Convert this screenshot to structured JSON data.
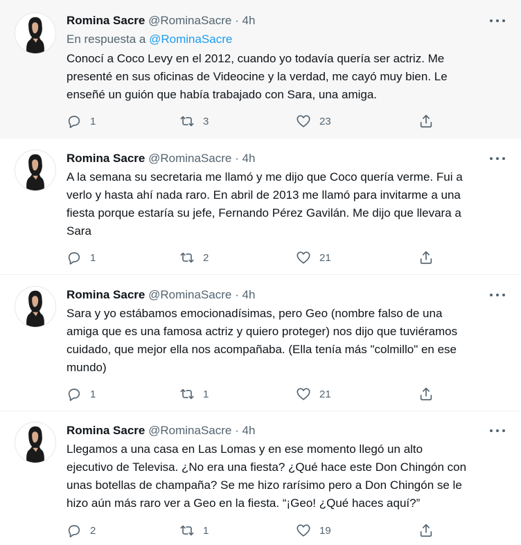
{
  "tweets": [
    {
      "name": "Romina Sacre",
      "handle": "@RominaSacre",
      "dot": "·",
      "time": "4h",
      "reply_prefix": "En respuesta a ",
      "reply_handle": "@RominaSacre",
      "text": "Conocí a Coco Levy en el 2012, cuando yo todavía quería ser actriz. Me\npresenté en sus oficinas de Videocine y la verdad, me cayó muy bien. Le\nenseñé un guión que había trabajado con Sara, una amiga.",
      "replies": "1",
      "retweets": "3",
      "likes": "23"
    },
    {
      "name": "Romina Sacre",
      "handle": "@RominaSacre",
      "dot": "·",
      "time": "4h",
      "text": "A la semana su secretaria me llamó y me dijo que Coco quería verme. Fui a\nverlo y hasta ahí nada raro. En abril de 2013 me llamó para invitarme a una\nfiesta porque estaría su jefe, Fernando Pérez Gavilán. Me dijo que llevara a\nSara",
      "replies": "1",
      "retweets": "2",
      "likes": "21"
    },
    {
      "name": "Romina Sacre",
      "handle": "@RominaSacre",
      "dot": "·",
      "time": "4h",
      "text": "Sara y yo estábamos emocionadísimas, pero Geo (nombre falso de una\namiga que es una famosa actriz y quiero proteger) nos dijo que tuviéramos\ncuidado, que mejor ella nos acompañaba. (Ella tenía más \"colmillo\" en ese\nmundo)",
      "replies": "1",
      "retweets": "1",
      "likes": "21"
    },
    {
      "name": "Romina Sacre",
      "handle": "@RominaSacre",
      "dot": "·",
      "time": "4h",
      "text": "Llegamos a una casa en Las Lomas y en ese momento llegó un alto\nejecutivo de Televisa. ¿No era una fiesta? ¿Qué hace este Don Chingón con\nunas botellas de champaña? Se me hizo rarísimo pero a Don Chingón  se le\nhizo aún más raro ver a Geo en la fiesta. “¡Geo! ¿Qué haces aquí?”",
      "replies": "2",
      "retweets": "1",
      "likes": "19"
    }
  ],
  "icons": {
    "reply": "reply-icon",
    "retweet": "retweet-icon",
    "like": "heart-icon",
    "share": "share-icon",
    "more": "more-icon"
  },
  "colors": {
    "text": "#0f1419",
    "secondary": "#536471",
    "link": "#1d9bf0",
    "highlight_bg": "#f7f7f7",
    "separator": "#eff3f4"
  }
}
